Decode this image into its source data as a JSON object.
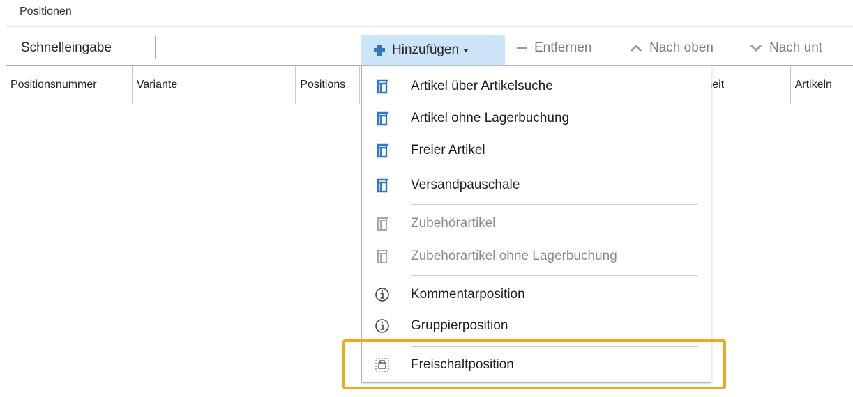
{
  "section_title": "Positionen",
  "toolbar": {
    "quick_entry_label": "Schnelleingabe",
    "quick_entry_value": "",
    "add_label": "Hinzufügen",
    "remove_label": "Entfernen",
    "up_label": "Nach oben",
    "down_label": "Nach unt"
  },
  "grid": {
    "columns": [
      "Positionsnummer",
      "Variante",
      "Positions",
      "heit",
      "Artikeln"
    ]
  },
  "menu": {
    "items": [
      {
        "label": "Artikel über Artikelsuche",
        "icon": "article-icon",
        "enabled": true
      },
      {
        "label": "Artikel ohne Lagerbuchung",
        "icon": "article-icon",
        "enabled": true
      },
      {
        "label": "Freier Artikel",
        "icon": "article-icon",
        "enabled": true
      },
      {
        "label": "Versandpauschale",
        "icon": "article-icon",
        "enabled": true
      },
      {
        "label": "Zubehörartikel",
        "icon": "article-icon",
        "enabled": false
      },
      {
        "label": "Zubehörartikel ohne Lagerbuchung",
        "icon": "article-icon",
        "enabled": false
      },
      {
        "label": "Kommentarposition",
        "icon": "info-icon",
        "enabled": true
      },
      {
        "label": "Gruppierposition",
        "icon": "info-icon",
        "enabled": true
      },
      {
        "label": "Freischaltposition",
        "icon": "unlock-position-icon",
        "enabled": true
      }
    ]
  },
  "colors": {
    "accent": "#2e78c4",
    "button_hover": "#cce4f7",
    "highlight": "#f0a722"
  }
}
